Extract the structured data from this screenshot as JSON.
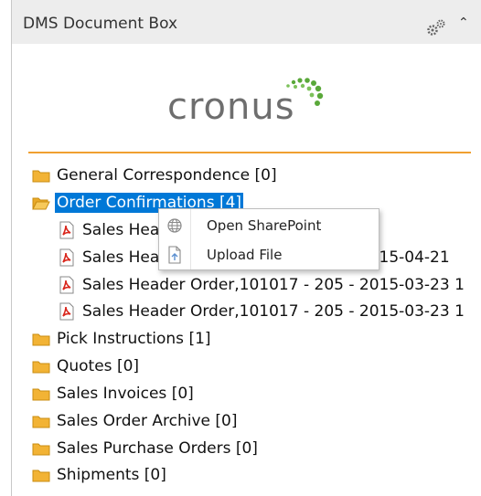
{
  "header": {
    "title": "DMS Document Box"
  },
  "logo": {
    "text": "cronus"
  },
  "tree": {
    "folders": [
      {
        "label": "General Correspondence [0]"
      },
      {
        "label": "Order Confirmations [4]"
      },
      {
        "label": "Pick Instructions [1]"
      },
      {
        "label": "Quotes [0]"
      },
      {
        "label": "Sales Invoices [0]"
      },
      {
        "label": "Sales Order Archive [0]"
      },
      {
        "label": "Sales Purchase Orders [0]"
      },
      {
        "label": "Shipments [0]"
      }
    ],
    "documents": [
      {
        "label": "Sales Header Order,102027 - 2015-"
      },
      {
        "label": "Sales Header Order,101017 - 205 - 2015-04-21"
      },
      {
        "label": "Sales Header Order,101017 - 205 - 2015-03-23 1"
      },
      {
        "label": "Sales Header Order,101017 - 205 - 2015-03-23 1"
      }
    ]
  },
  "context_menu": {
    "items": [
      {
        "label": "Open SharePoint",
        "icon": "globe-icon"
      },
      {
        "label": "Upload File",
        "icon": "upload-file-icon"
      }
    ]
  },
  "colors": {
    "selection": "#0078d7",
    "divider": "#f0a030",
    "folder": "#f2b335",
    "pdf": "#d9261c",
    "logo_dots": "#5aa83a"
  }
}
